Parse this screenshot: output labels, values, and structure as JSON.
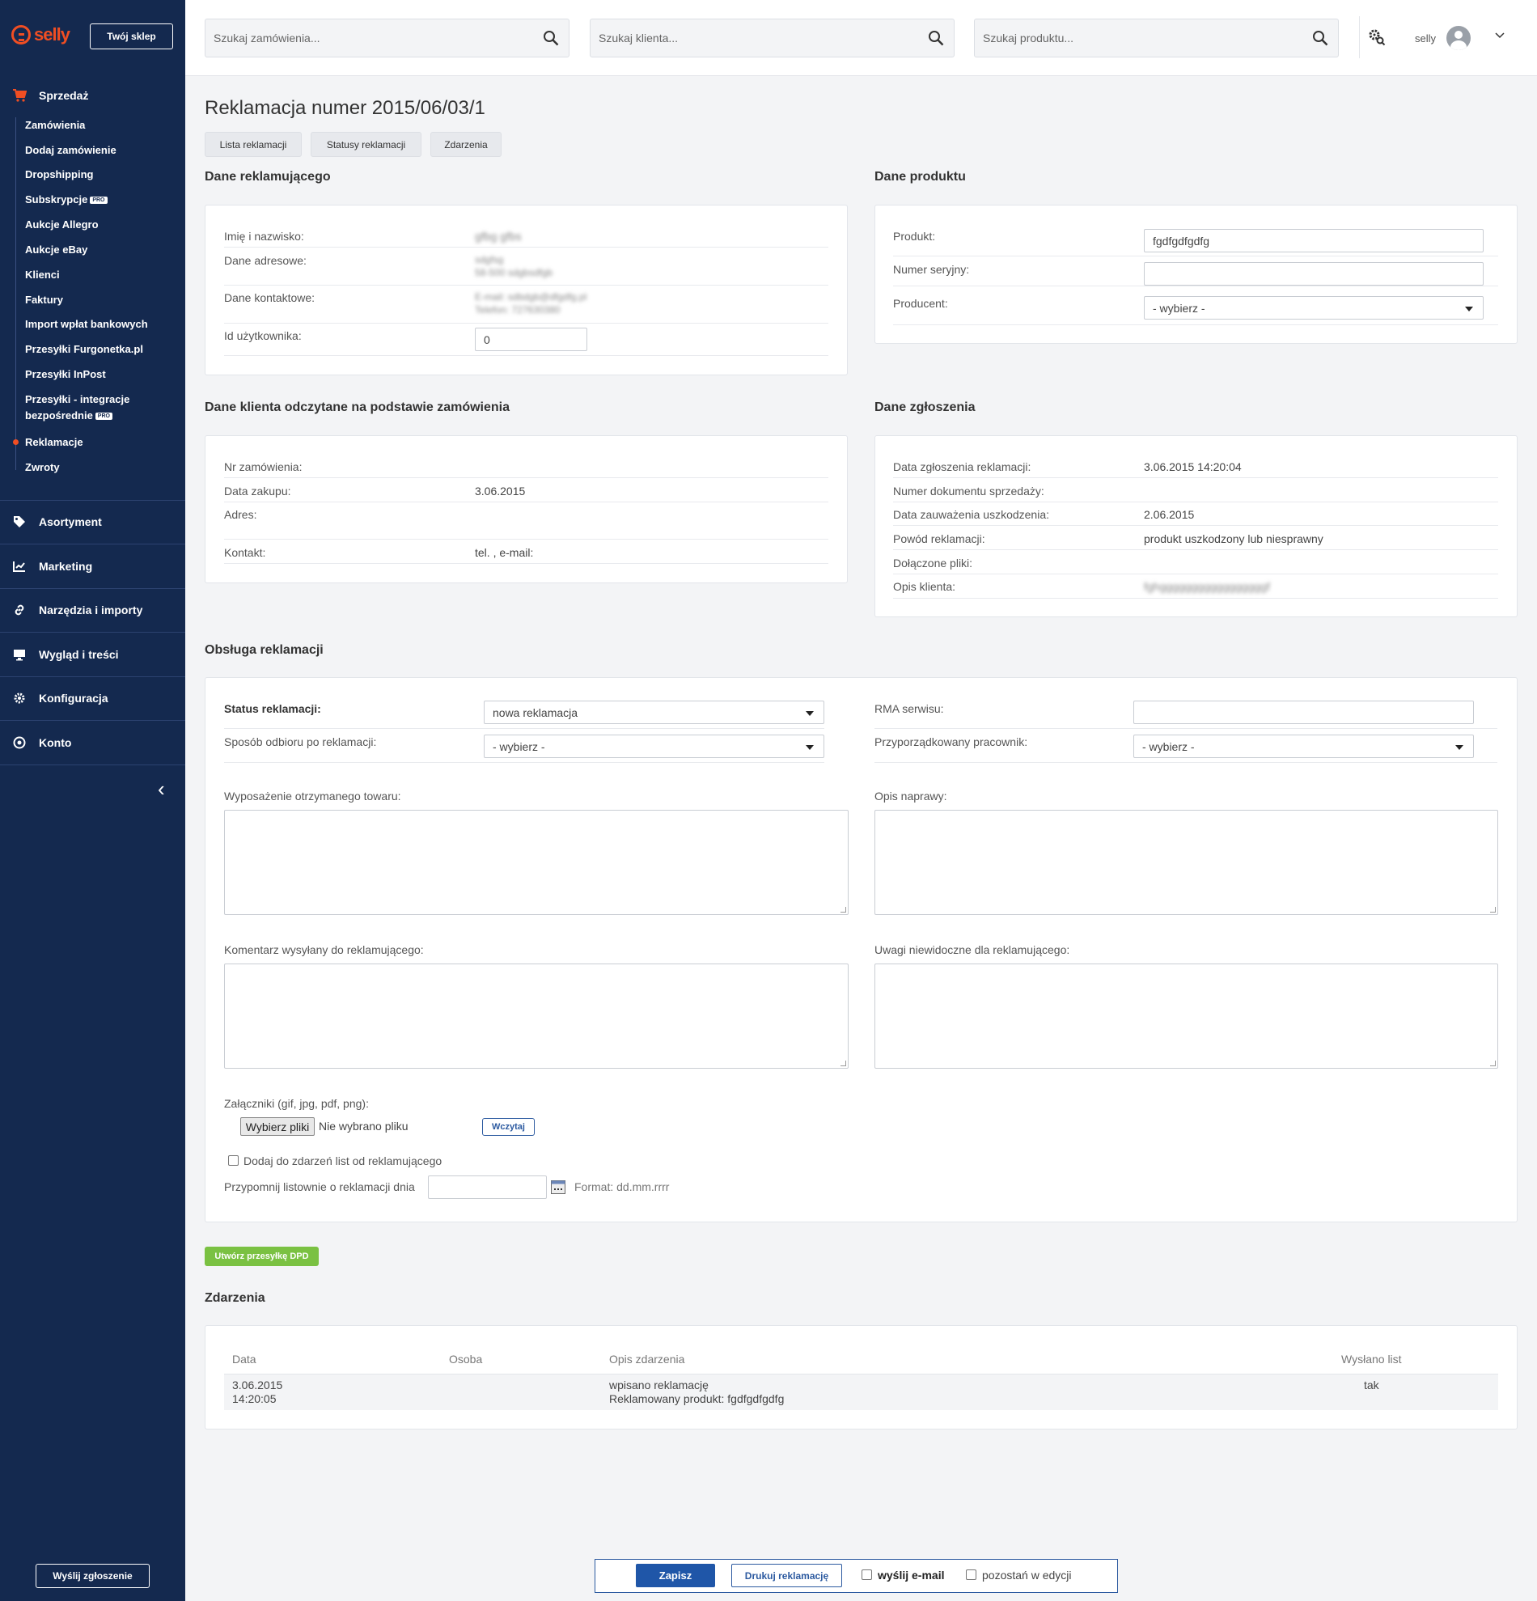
{
  "sidebar": {
    "logo_text": "selly",
    "shop_button": "Twój sklep",
    "sales_label": "Sprzedaż",
    "sub_items": [
      {
        "label": "Zamówienia"
      },
      {
        "label": "Dodaj zamówienie"
      },
      {
        "label": "Dropshipping"
      },
      {
        "label": "Subskrypcje",
        "badge": "PRO"
      },
      {
        "label": "Aukcje Allegro"
      },
      {
        "label": "Aukcje eBay"
      },
      {
        "label": "Klienci"
      },
      {
        "label": "Faktury"
      },
      {
        "label": "Import wpłat bankowych"
      },
      {
        "label": "Przesyłki Furgonetka.pl"
      },
      {
        "label": "Przesyłki InPost"
      },
      {
        "label": "Przesyłki - integracje",
        "label2": "bezpośrednie",
        "badge": "PRO"
      },
      {
        "label": "Reklamacje",
        "active": true
      },
      {
        "label": "Zwroty"
      }
    ],
    "main_items": [
      {
        "label": "Asortyment",
        "icon": "tag-icon"
      },
      {
        "label": "Marketing",
        "icon": "chart-line-icon"
      },
      {
        "label": "Narzędzia i importy",
        "icon": "link-icon"
      },
      {
        "label": "Wygląd i treści",
        "icon": "monitor-icon"
      },
      {
        "label": "Konfiguracja",
        "icon": "gear-icon"
      },
      {
        "label": "Konto",
        "icon": "account-icon"
      }
    ],
    "send_report": "Wyślij zgłoszenie",
    "accent": "#f04e23",
    "bg": "#14294f"
  },
  "topbar": {
    "search_orders_placeholder": "Szukaj zamówienia...",
    "search_clients_placeholder": "Szukaj klienta...",
    "search_products_placeholder": "Szukaj produktu...",
    "user": "selly"
  },
  "page": {
    "title": "Reklamacja numer 2015/06/03/1",
    "tabs": [
      "Lista reklamacji",
      "Statusy reklamacji",
      "Zdarzenia"
    ]
  },
  "complainant": {
    "title": "Dane reklamującego",
    "name_label": "Imię i nazwisko:",
    "name_value": "gfbg gfbs",
    "address_label": "Dane adresowe:",
    "address_line1": "sdgfsg",
    "address_line2": "58-500 sdgbsdfgb",
    "contact_label": "Dane kontaktowe:",
    "contact_line1": "E-mail: sdbdgb@dfgdfg.pl",
    "contact_line2": "Telefon: 727630380",
    "user_id_label": "Id użytkownika:",
    "user_id_value": "0"
  },
  "product": {
    "title": "Dane produktu",
    "product_label": "Produkt:",
    "product_value": "fgdfgdfgdfg",
    "serial_label": "Numer seryjny:",
    "serial_value": "",
    "producer_label": "Producent:",
    "producer_value": "- wybierz -"
  },
  "order_client": {
    "title": "Dane klienta odczytane na podstawie zamówienia",
    "order_no_label": "Nr zamówienia:",
    "purchase_date_label": "Data zakupu:",
    "purchase_date_value": "3.06.2015",
    "address_label": "Adres:",
    "contact_label": "Kontakt:",
    "contact_value": "tel. , e-mail:"
  },
  "submission": {
    "title": "Dane zgłoszenia",
    "rows": [
      {
        "label": "Data zgłoszenia reklamacji:",
        "value": "3.06.2015 14:20:04"
      },
      {
        "label": "Numer dokumentu sprzedaży:",
        "value": ""
      },
      {
        "label": "Data zauważenia uszkodzenia:",
        "value": "2.06.2015"
      },
      {
        "label": "Powód reklamacji:",
        "value": "produkt uszkodzony lub niesprawny"
      },
      {
        "label": "Dołączone pliki:",
        "value": ""
      },
      {
        "label": "Opis klienta:",
        "value": "fghgggggggggggggggggf"
      }
    ]
  },
  "handling": {
    "title": "Obsługa reklamacji",
    "status_label": "Status reklamacji:",
    "status_value": "nowa reklamacja",
    "pickup_label": "Sposób odbioru po reklamacji:",
    "pickup_value": "- wybierz -",
    "rma_label": "RMA serwisu:",
    "rma_value": "",
    "employee_label": "Przyporządkowany pracownik:",
    "employee_value": "- wybierz -",
    "equipment_label": "Wyposażenie otrzymanego towaru:",
    "repair_label": "Opis naprawy:",
    "comment_label": "Komentarz wysyłany do reklamującego:",
    "notes_label": "Uwagi niewidoczne dla reklamującego:",
    "attachments_label": "Załączniki (gif, jpg, pdf, png):",
    "choose_files": "Wybierz pliki",
    "no_file": "Nie wybrano pliku",
    "upload": "Wczytaj",
    "add_events_label": "Dodaj do zdarzeń list od reklamującego",
    "remind_label": "Przypomnij listownie o reklamacji dnia",
    "format_hint": "Format: dd.mm.rrrr"
  },
  "dpd_button": "Utwórz przesyłkę DPD",
  "events": {
    "title": "Zdarzenia",
    "headers": [
      "Data",
      "Osoba",
      "Opis zdarzenia",
      "Wysłano list"
    ],
    "rows": [
      {
        "date1": "3.06.2015",
        "date2": "14:20:05",
        "person": "",
        "desc1": "wpisano reklamację",
        "desc2": "Reklamowany produkt: fgdfgdfgdfg",
        "sent": "tak"
      }
    ]
  },
  "bottom": {
    "save": "Zapisz",
    "print": "Drukuj reklamację",
    "send_email": "wyślij e-mail",
    "stay_edit": "pozostań w edycji"
  }
}
